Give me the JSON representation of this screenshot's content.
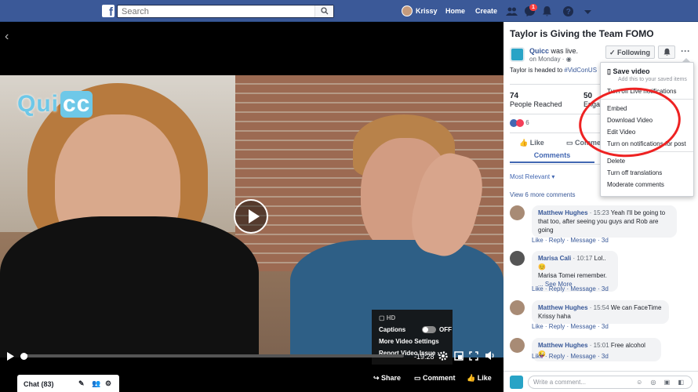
{
  "topbar": {
    "logo": "f",
    "search_placeholder": "Search",
    "user_name": "Krissy",
    "home_label": "Home",
    "create_label": "Create",
    "messages_badge": "1",
    "icons": [
      "friends-icon",
      "messenger-icon",
      "bell-icon",
      "help-icon",
      "dropdown-icon"
    ]
  },
  "video": {
    "overlay_logo_a": "Qui",
    "overlay_logo_b": "cc",
    "time_remaining": "-19:28",
    "progress_fraction": 0.01,
    "settings": {
      "hd_label": "HD",
      "captions_label": "Captions",
      "captions_state": "OFF",
      "more_settings": "More Video Settings",
      "report": "Report Video Issue"
    },
    "chat_label": "Chat (83)",
    "share_label": "Share",
    "comment_label": "Comment",
    "like_label": "Like"
  },
  "panel": {
    "title": "Taylor is Giving the Team FOMO",
    "page_name": "Quicc",
    "page_status": " was live.",
    "date": "on Monday · ",
    "follow_label": "Following",
    "description_prefix": "Taylor is headed to ",
    "description_tag": "#VidConUS",
    "stat1_value": "74",
    "stat1_label": "People Reached",
    "stat2_value": "50",
    "stat2_label": "Engag",
    "reaction_count": "6",
    "like_label": "Like",
    "comment_label": "Comme",
    "comments_tab": "Comments",
    "sort_label": "Most Relevant ▾",
    "view_more": "View 6 more comments",
    "write_placeholder": "Write a comment...",
    "comments": [
      {
        "name": "Matthew Hughes",
        "time": " · 15:23",
        "text1": " Yeah I'll be going to",
        "text2": "that too, after seeing you guys and Rob are",
        "text3": "going",
        "actions": "Like · Reply · Message · 3d"
      },
      {
        "name": "Marisa Cali",
        "time": " · 10:17",
        "text1": " Lol.. 😊",
        "text2": "Marisa Tomei remember.",
        "text3": "... See More",
        "actions": "Like · Reply · Message · 3d"
      },
      {
        "name": "Matthew Hughes",
        "time": " · 15:54",
        "text1": " We can FaceTime",
        "text2": "Krissy haha",
        "text3": "",
        "actions": "Like · Reply · Message · 3d"
      },
      {
        "name": "Matthew Hughes",
        "time": " · 15:01",
        "text1": " Free alcohol 😜",
        "text2": "",
        "text3": "",
        "actions": "Like · Reply · Message · 3d"
      }
    ]
  },
  "menu": {
    "save_title": "Save video",
    "save_sub": "Add this to your saved items",
    "live_notif": "Turn off Live notifications",
    "embed": "Embed",
    "download": "Download Video",
    "edit": "Edit Video",
    "notif_post": "Turn on notifications for post",
    "delete": "Delete",
    "translations": "Turn off translations",
    "moderate": "Moderate comments"
  },
  "colors": {
    "brand": "#3b5998",
    "link": "#385898",
    "annotation": "#ee2222"
  }
}
